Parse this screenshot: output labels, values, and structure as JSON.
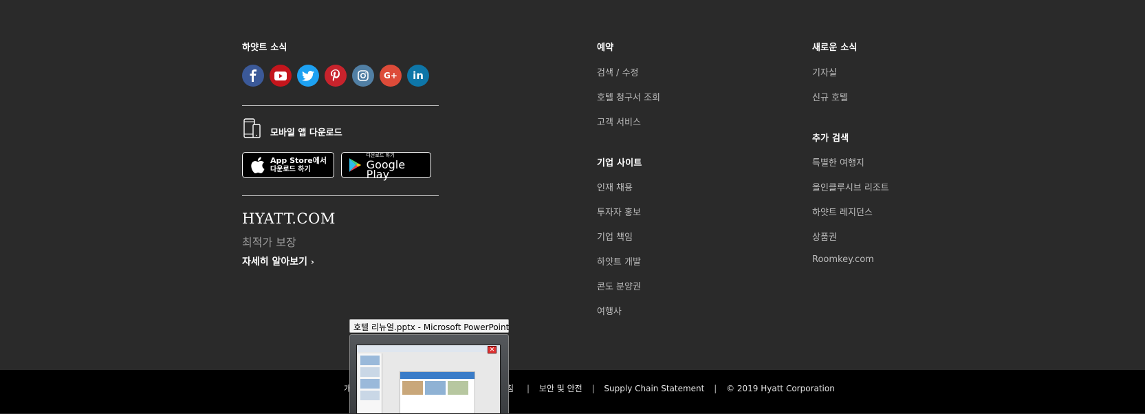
{
  "news": {
    "title": "하얏트 소식",
    "social": [
      {
        "name": "facebook-icon",
        "glyph": "f",
        "color": "#3b5998"
      },
      {
        "name": "youtube-icon",
        "glyph": "▶",
        "color": "#c4151c"
      },
      {
        "name": "twitter-icon",
        "glyph": "t",
        "color": "#1da1f2"
      },
      {
        "name": "pinterest-icon",
        "glyph": "P",
        "color": "#c8232c"
      },
      {
        "name": "instagram-icon",
        "glyph": "◎",
        "color": "#517fa4"
      },
      {
        "name": "google-plus-icon",
        "glyph": "G+",
        "color": "#dd4b39"
      },
      {
        "name": "linkedin-icon",
        "glyph": "in",
        "color": "#0e76a8"
      }
    ]
  },
  "app": {
    "download_label": "모바일 앱 다운로드",
    "appstore_line1": "App Store에서",
    "appstore_line2": "다운로드 하기",
    "googleplay_small": "다운로드 하기",
    "googleplay_big": "Google Play"
  },
  "promo": {
    "logo": "HYATT.COM",
    "subtitle": "최적가 보장",
    "learn_more": "자세히 알아보기"
  },
  "reservation": {
    "title": "예약",
    "links": [
      "검색 / 수정",
      "호텔 청구서 조회",
      "고객 서비스"
    ]
  },
  "corporate": {
    "title": "기업 사이트",
    "links": [
      "인재 채용",
      "투자자 홍보",
      "기업 책임",
      "하얏트 개발",
      "콘도 분양권",
      "여행사"
    ]
  },
  "whats_new": {
    "title": "새로운 소식",
    "links": [
      "기자실",
      "신규 호텔"
    ]
  },
  "more": {
    "title": "추가 검색",
    "links": [
      "특별한 여행지",
      "올인클루시브 리조트",
      "하얏트 레지던스",
      "상품권",
      "Roomkey.com"
    ]
  },
  "bottom": {
    "partial_left": "개",
    "partial_mid": "침",
    "safety": "보안 및 안전",
    "supply_chain": "Supply Chain Statement",
    "copyright": "© 2019 Hyatt Corporation"
  },
  "taskbar_preview": {
    "title": "호텔 리뉴얼.pptx - Microsoft PowerPoint",
    "close_glyph": "✕"
  }
}
